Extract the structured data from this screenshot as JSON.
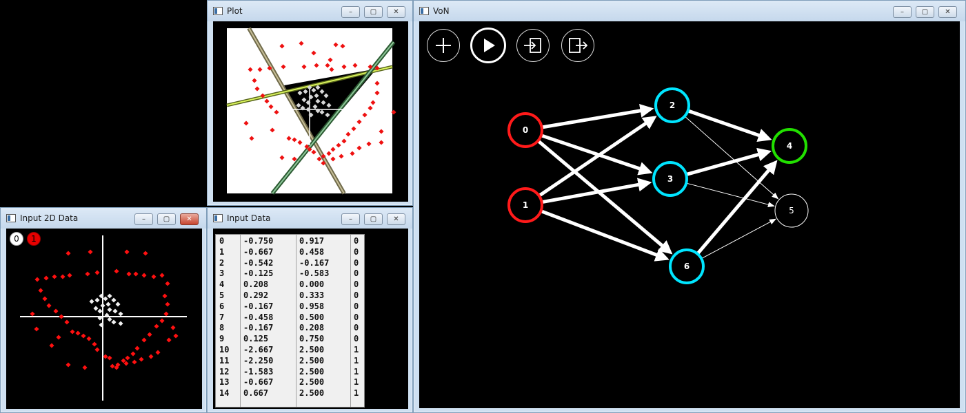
{
  "windows": {
    "input2d": {
      "title": "Input 2D Data"
    },
    "plot": {
      "title": "Plot"
    },
    "inputdata": {
      "title": "Input Data"
    },
    "von": {
      "title": "VoN"
    }
  },
  "window_controls": {
    "minimize": "–",
    "restore": "▢",
    "close": "✕"
  },
  "legend": {
    "class0": "0",
    "class1": "1",
    "class0_color": "#ffffff",
    "class1_color": "#ff0000"
  },
  "input_table": {
    "rows": [
      [
        "0",
        "-0.750",
        "0.917",
        "0"
      ],
      [
        "1",
        "-0.667",
        "0.458",
        "0"
      ],
      [
        "2",
        "-0.542",
        "-0.167",
        "0"
      ],
      [
        "3",
        "-0.125",
        "-0.583",
        "0"
      ],
      [
        "4",
        "0.208",
        "0.000",
        "0"
      ],
      [
        "5",
        "0.292",
        "0.333",
        "0"
      ],
      [
        "6",
        "-0.167",
        "0.958",
        "0"
      ],
      [
        "7",
        "-0.458",
        "0.500",
        "0"
      ],
      [
        "8",
        "-0.167",
        "0.208",
        "0"
      ],
      [
        "9",
        "0.125",
        "0.750",
        "0"
      ],
      [
        "10",
        "-2.667",
        "2.500",
        "1"
      ],
      [
        "11",
        "-2.250",
        "2.500",
        "1"
      ],
      [
        "12",
        "-1.583",
        "2.500",
        "1"
      ],
      [
        "13",
        "-0.667",
        "2.500",
        "1"
      ],
      [
        "14",
        "0.667",
        "2.500",
        "1"
      ]
    ]
  },
  "toolbar": {
    "icons": [
      "plus-icon",
      "play-icon",
      "import-icon",
      "export-icon"
    ]
  },
  "network": {
    "nodes": [
      {
        "id": "0",
        "color": "#ff1a1a"
      },
      {
        "id": "1",
        "color": "#ff1a1a"
      },
      {
        "id": "2",
        "color": "#00e5ff"
      },
      {
        "id": "3",
        "color": "#00e5ff"
      },
      {
        "id": "6",
        "color": "#00e5ff"
      },
      {
        "id": "4",
        "color": "#22e000"
      },
      {
        "id": "5",
        "color": "#ffffff"
      }
    ],
    "edges": [
      {
        "from": "0",
        "to": "2",
        "weight": "strong"
      },
      {
        "from": "0",
        "to": "3",
        "weight": "strong"
      },
      {
        "from": "0",
        "to": "6",
        "weight": "strong"
      },
      {
        "from": "1",
        "to": "2",
        "weight": "strong"
      },
      {
        "from": "1",
        "to": "3",
        "weight": "strong"
      },
      {
        "from": "1",
        "to": "6",
        "weight": "strong"
      },
      {
        "from": "2",
        "to": "4",
        "weight": "strong"
      },
      {
        "from": "2",
        "to": "5",
        "weight": "thin"
      },
      {
        "from": "3",
        "to": "4",
        "weight": "strong"
      },
      {
        "from": "3",
        "to": "5",
        "weight": "thin"
      },
      {
        "from": "6",
        "to": "4",
        "weight": "strong"
      },
      {
        "from": "6",
        "to": "5",
        "weight": "thin"
      }
    ]
  }
}
